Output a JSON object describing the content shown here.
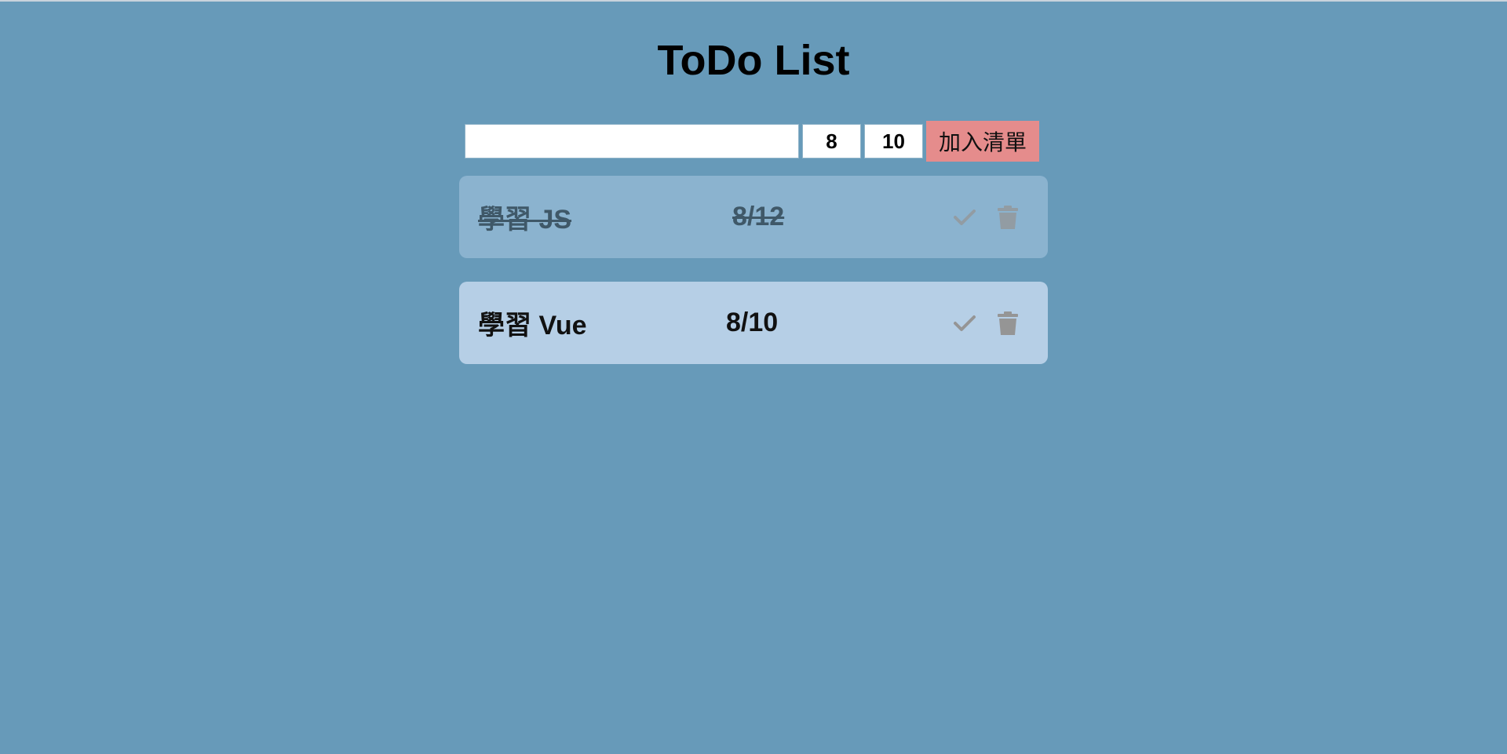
{
  "app": {
    "title": "ToDo List"
  },
  "form": {
    "task_value": "",
    "month_value": "8",
    "day_value": "10",
    "add_button_label": "加入清單"
  },
  "todos": [
    {
      "text": "學習 JS",
      "date": "8/12",
      "done": true
    },
    {
      "text": "學習 Vue",
      "date": "8/10",
      "done": false
    }
  ],
  "colors": {
    "background": "#679ab9",
    "add_button": "#e58c8c",
    "done_item": "#8bb3cf",
    "pending_item": "#b6cfe6",
    "icon": "#959595"
  },
  "icons": {
    "complete": "check-icon",
    "delete": "trash-icon"
  }
}
